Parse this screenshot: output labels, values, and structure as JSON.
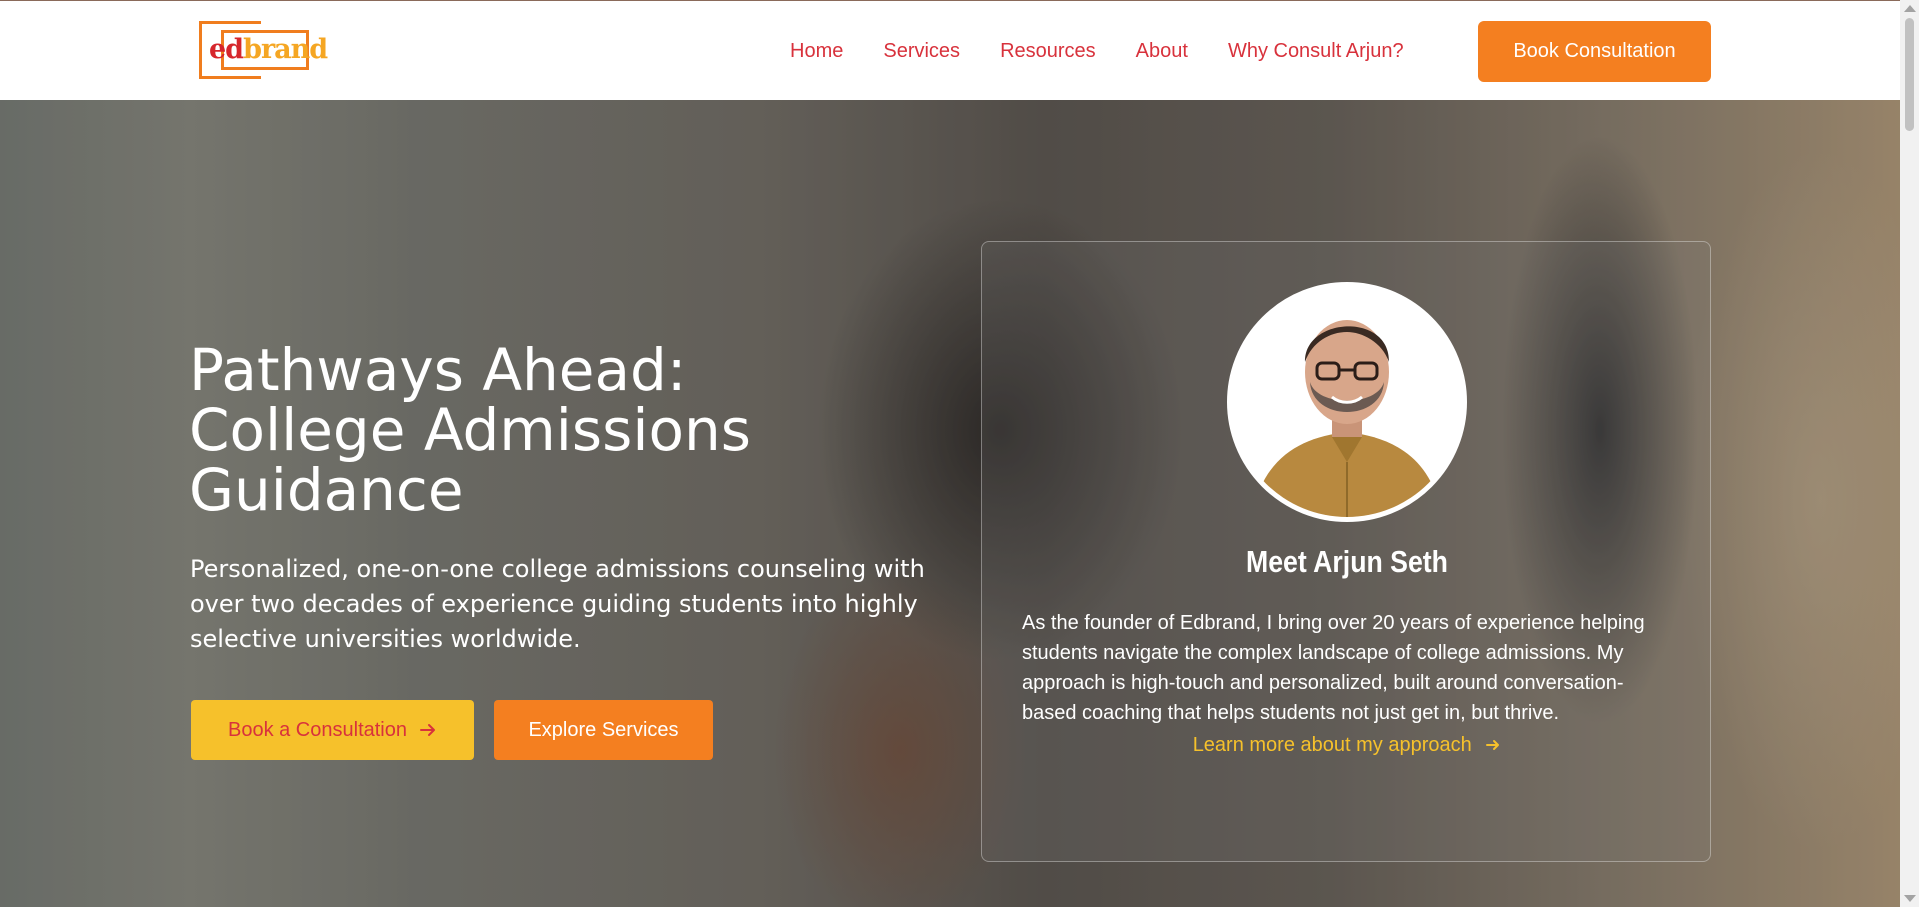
{
  "header": {
    "logo": {
      "ed": "ed",
      "brand": "brand"
    },
    "nav": [
      "Home",
      "Services",
      "Resources",
      "About",
      "Why Consult Arjun?"
    ],
    "cta_label": "Book Consultation"
  },
  "hero": {
    "title_line1": "Pathways Ahead:",
    "title_line2": "College Admissions",
    "title_line3": "Guidance",
    "subtitle": "Personalized, one-on-one college admissions counseling with over two decades of experience guiding students into highly selective universities worldwide.",
    "primary_button": "Book a Consultation",
    "secondary_button": "Explore Services"
  },
  "card": {
    "name": "Meet Arjun Seth",
    "bio": "As the founder of Edbrand, I bring over 20 years of experience helping students navigate the complex landscape of college admissions. My approach is high-touch and personalized, built around conversation-based coaching that helps students not just get in, but thrive.",
    "link": "Learn more about my approach"
  },
  "colors": {
    "accent_orange": "#f47f20",
    "accent_yellow": "#f6c12b",
    "nav_red": "#d8323c"
  },
  "icons": {
    "button_arrow": "arrow-right-icon",
    "link_arrow": "arrow-right-icon"
  }
}
